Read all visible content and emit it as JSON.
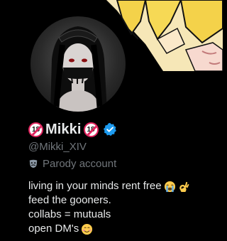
{
  "profile": {
    "age_badge_left": "18",
    "name": "Mikki",
    "age_badge_right": "18",
    "handle": "@Mikki_XIV",
    "label": "Parody account",
    "bio": {
      "line1": "living in your minds rent free",
      "line2": "feed the gooners.",
      "line3": "collabs = mutuals",
      "line4": "open DM's"
    },
    "icons": {
      "verified": "verified-badge-icon",
      "label": "theater-mask-icon",
      "line1_emojis": [
        "loudly-crying-face-emoji",
        "ok-hand-emoji"
      ],
      "line4_emoji": "smiling-face-emoji"
    }
  },
  "colors": {
    "background": "#000000",
    "text": "#e7e9ea",
    "secondary_text": "#71767b",
    "verified_blue": "#1d9bf0",
    "age_badge_red": "#e0245e"
  }
}
